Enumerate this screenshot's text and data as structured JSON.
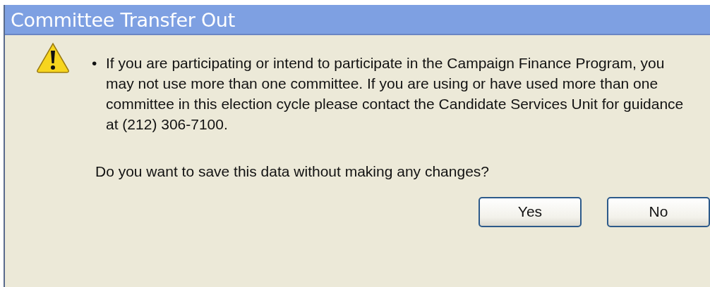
{
  "window": {
    "title": "Committee Transfer Out"
  },
  "message": {
    "bullet": "•",
    "text": "If you are participating or intend to participate in the Campaign Finance Program, you may not use more than one committee. If you are using or have used more than one committee in this election cycle please contact the Candidate Services Unit for guidance at (212) 306-7100."
  },
  "question": "Do you want to save this data without making any changes?",
  "buttons": [
    "Yes",
    "No"
  ]
}
